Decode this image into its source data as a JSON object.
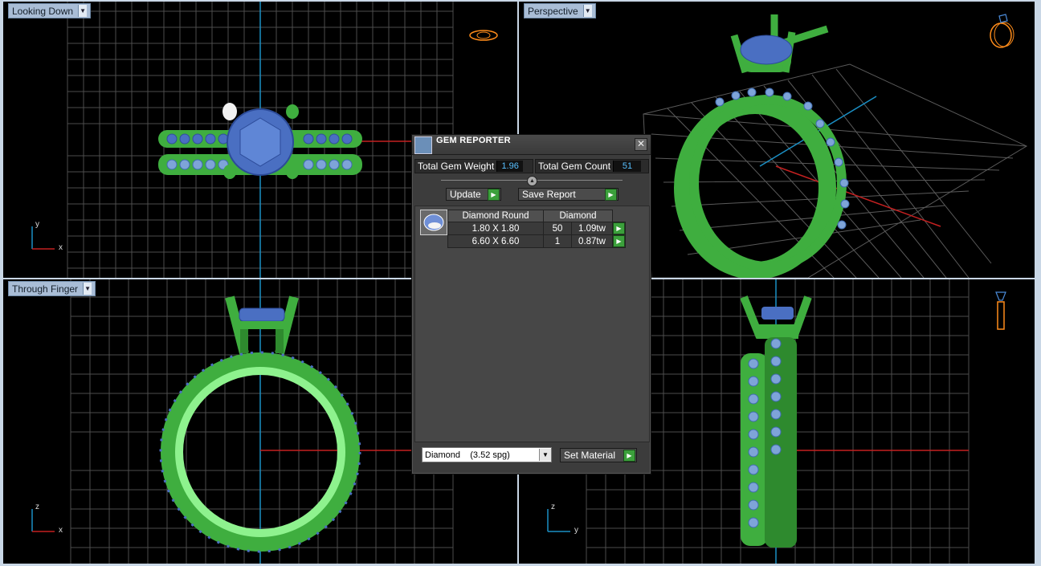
{
  "viewports": {
    "top_left": {
      "title": "Looking Down",
      "axis_v": "y",
      "axis_h": "x"
    },
    "top_right": {
      "title": "Perspective"
    },
    "bottom_left": {
      "title": "Through Finger",
      "axis_v": "z",
      "axis_h": "x"
    },
    "bottom_right": {
      "title": "",
      "axis_v": "z",
      "axis_h": "y"
    }
  },
  "icons": {
    "view_icon_top_left": "ring-top-view-icon",
    "view_icon_top_right": "ring-perspective-icon",
    "view_icon_bottom_right": "ring-side-view-icon",
    "dropdown": "chevron-down-icon",
    "go": "play-arrow-icon"
  },
  "colors": {
    "ring_green": "#3fae3f",
    "gem_blue": "#4a6fc2",
    "grid": "#5a5a5a",
    "axis_red": "#c42020",
    "axis_cyan": "#1b8fc4",
    "viewport_title_bg": "#a9bdd6"
  },
  "gem_reporter": {
    "title": "GEM REPORTER",
    "close": "✕",
    "total_weight_label": "Total Gem Weight",
    "total_weight_value": "1.96",
    "total_count_label": "Total Gem Count",
    "total_count_value": "51",
    "update_label": "Update",
    "save_report_label": "Save Report",
    "go_glyph": "▶",
    "table": {
      "headers": [
        "Diamond Round",
        "Diamond"
      ],
      "rows": [
        {
          "size": "1.80 X 1.80",
          "count": "50",
          "weight": "1.09tw"
        },
        {
          "size": "6.60 X 6.60",
          "count": "1",
          "weight": "0.87tw"
        }
      ]
    },
    "material_select": "Diamond    (3.52 spg)",
    "set_material_label": "Set Material"
  }
}
